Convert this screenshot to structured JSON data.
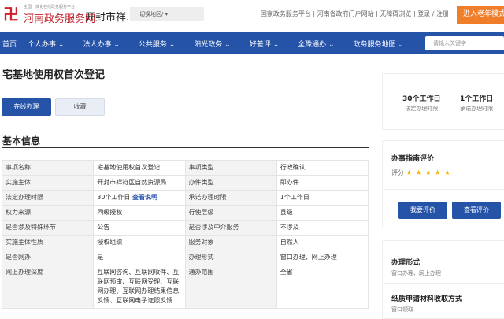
{
  "header": {
    "logo_subtitle": "全国一体化在线政务服务平台",
    "logo_title": "河南政务服务网",
    "city": "开封市祥...",
    "region": "切换地区/",
    "links": [
      "国家政务服务平台",
      "河南省政府门户网站",
      "无障碍浏览",
      "登录 / 注册"
    ],
    "elder_button": "进入老年模式"
  },
  "nav": {
    "items": [
      "首页",
      "个人办事",
      "法人办事",
      "公共服务",
      "阳光政务",
      "好差评",
      "全豫通办",
      "政务服务地图"
    ],
    "search_placeholder": "请输入关键字"
  },
  "page": {
    "title": "宅基地使用权首次登记",
    "online_button": "在线办理",
    "favorite_button": "收藏",
    "section": "基本信息",
    "view_note_link": "查看说明"
  },
  "table": [
    [
      "事项名称",
      "宅基地使用权首次登记",
      "事项类型",
      "行政确认"
    ],
    [
      "实施主体",
      "开封市祥符区自然资源局",
      "办件类型",
      "即办件"
    ],
    [
      "法定办理时限",
      "30个工作日",
      "承诺办理时限",
      "1个工作日"
    ],
    [
      "权力来源",
      "同级授权",
      "行使层级",
      "县级"
    ],
    [
      "是否涉及特殊环节",
      "公告",
      "是否涉及中介服务",
      "不涉及"
    ],
    [
      "实施主体性质",
      "授权组织",
      "服务对象",
      "自然人"
    ],
    [
      "是否网办",
      "是",
      "办理形式",
      "窗口办理、网上办理"
    ],
    [
      "网上办理深度",
      "互联网咨询、互联网收件、互联网预审、互联网受理、互联网办理、互联网办理结果信息反馈、互联网电子证照反馈",
      "通办范围",
      "全省"
    ]
  ],
  "sidebar": {
    "legal_days": "30个工作日",
    "legal_label": "法定办理时限",
    "promise_days": "1个工作日",
    "promise_label": "承诺办理时限",
    "eval_title": "办事指南评价",
    "score_label": "评分",
    "stars": 5,
    "eval_button": "我要评价",
    "view_eval_button": "查看评价",
    "form_title": "办理形式",
    "form_value": "窗口办理、网上办理",
    "paper_title": "纸质申请材料收取方式",
    "paper_value": "窗口领取"
  },
  "colors": {
    "primary": "#2553a8",
    "accent": "#f07d2a",
    "star": "#f4b400"
  }
}
